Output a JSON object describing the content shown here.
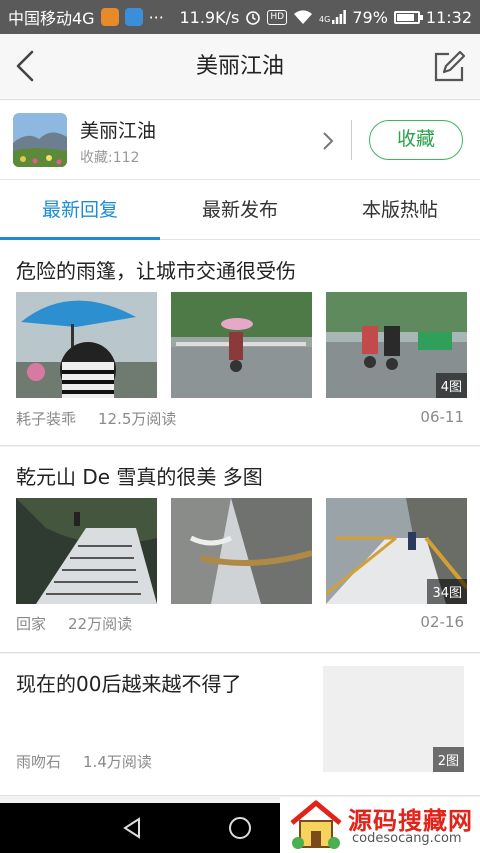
{
  "status_bar": {
    "carrier": "中国移动4G",
    "more": "···",
    "speed": "11.9K/s",
    "hd": "HD",
    "network": "4G",
    "battery": "79%",
    "battery_level": 0.79,
    "time": "11:32"
  },
  "nav": {
    "title": "美丽江油",
    "back_icon": "chevron-left-icon",
    "edit_icon": "edit-icon"
  },
  "forum": {
    "name": "美丽江油",
    "favorites": "收藏:112",
    "favorite_button": "收藏",
    "accent_color": "#2aa14a"
  },
  "tabs": [
    {
      "label": "最新回复",
      "active": true
    },
    {
      "label": "最新发布",
      "active": false
    },
    {
      "label": "本版热帖",
      "active": false
    }
  ],
  "tab_accent_color": "#1e8cd2",
  "posts": [
    {
      "title": "危险的雨篷，让城市交通很受伤",
      "author": "耗子装乖",
      "reads": "12.5万阅读",
      "date": "06-11",
      "image_count": "4图"
    },
    {
      "title": "乾元山 De 雪真的很美 多图",
      "author": "回家",
      "reads": "22万阅读",
      "date": "02-16",
      "image_count": "34图"
    },
    {
      "title": "现在的00后越来越不得了",
      "author": "雨吻石",
      "reads": "1.4万阅读",
      "date": "",
      "image_count": "2图"
    }
  ],
  "ad": {
    "title": "源码搜藏网",
    "url": "codesocang.com"
  }
}
